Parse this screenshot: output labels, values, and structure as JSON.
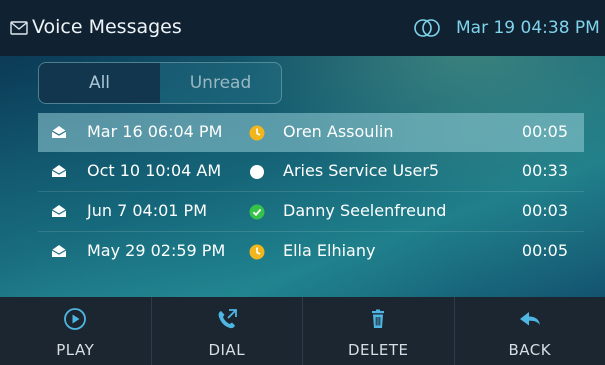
{
  "header": {
    "title": "Voice Messages",
    "datetime": "Mar 19 04:38 PM",
    "icons": [
      "envelope-icon",
      "linked-rings-icon"
    ]
  },
  "filter": {
    "tabs": [
      {
        "label": "All",
        "selected": true
      },
      {
        "label": "Unread",
        "selected": false
      }
    ]
  },
  "messages": [
    {
      "date": "Mar 16 06:04 PM",
      "status": "clock-icon",
      "name": "Oren Assoulin",
      "duration": "00:05",
      "selected": true
    },
    {
      "date": "Oct 10 10:04 AM",
      "status": "dot-icon",
      "name": "Aries Service User5",
      "duration": "00:33",
      "selected": false
    },
    {
      "date": "Jun 7 04:01 PM",
      "status": "check-icon",
      "name": "Danny Seelenfreund",
      "duration": "00:03",
      "selected": false
    },
    {
      "date": "May 29 02:59 PM",
      "status": "clock-icon",
      "name": "Ella Elhiany",
      "duration": "00:05",
      "selected": false
    }
  ],
  "toolbar": {
    "play": "PLAY",
    "dial": "DIAL",
    "delete": "DELETE",
    "back": "BACK"
  },
  "colors": {
    "accent": "#7fd3ea",
    "clock": "#f2b51c",
    "check": "#37c24a"
  }
}
